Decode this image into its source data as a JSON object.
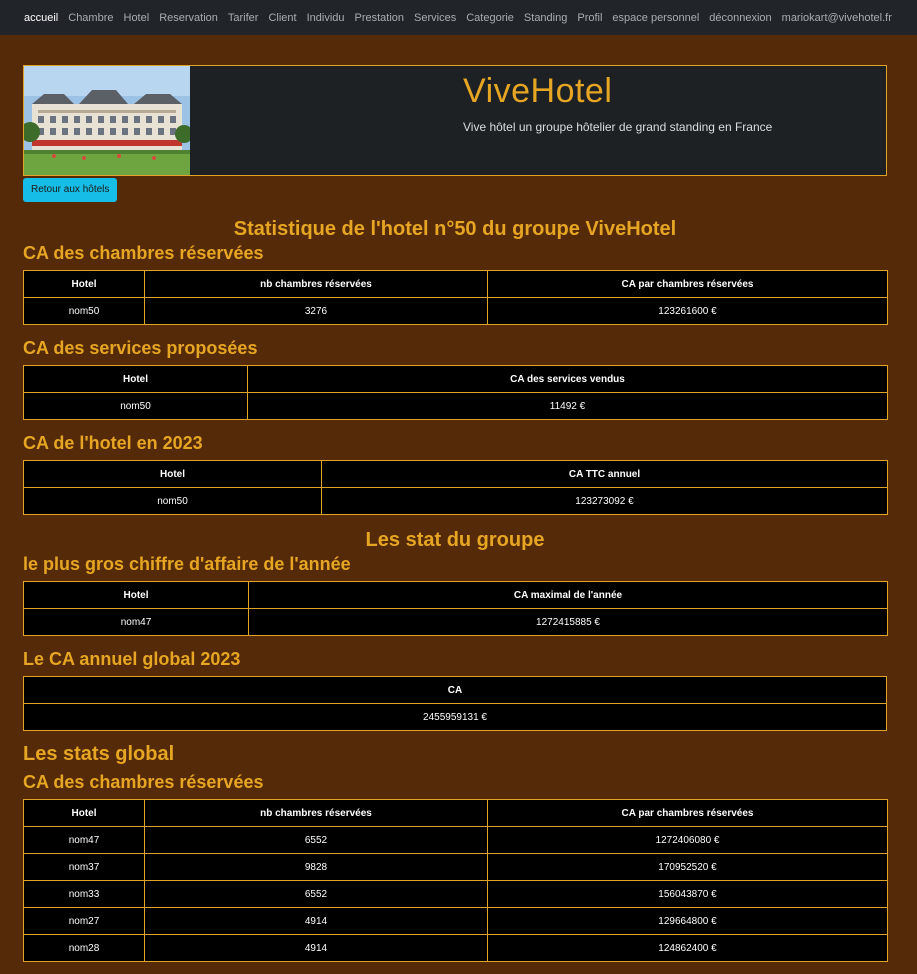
{
  "nav": {
    "items": [
      "accueil",
      "Chambre",
      "Hotel",
      "Reservation",
      "Tarifer",
      "Client",
      "Individu",
      "Prestation",
      "Services",
      "Categorie",
      "Standing",
      "Profil",
      "espace personnel",
      "déconnexion",
      "mariokart@vivehotel.fr"
    ]
  },
  "header": {
    "title": "ViveHotel",
    "subtitle": "Vive hôtel un groupe hôtelier de grand standing en France"
  },
  "back_button": "Retour aux hôtels",
  "page_title": "Statistique de l'hotel n°50 du groupe ViveHotel",
  "hotel_stats": {
    "rooms": {
      "title": "CA des chambres réservées",
      "headers": [
        "Hotel",
        "nb chambres réservées",
        "CA par chambres réservées"
      ],
      "rows": [
        [
          "nom50",
          "3276",
          "123261600 €"
        ]
      ]
    },
    "services": {
      "title": "CA des services proposées",
      "headers": [
        "Hotel",
        "CA des services vendus"
      ],
      "rows": [
        [
          "nom50",
          "11492 €"
        ]
      ]
    },
    "annual": {
      "title": "CA de l'hotel en 2023",
      "headers": [
        "Hotel",
        "CA TTC annuel"
      ],
      "rows": [
        [
          "nom50",
          "123273092 €"
        ]
      ]
    }
  },
  "group_title": "Les stat du groupe",
  "group_stats": {
    "max": {
      "title": "le plus gros chiffre d'affaire de l'année",
      "headers": [
        "Hotel",
        "CA maximal de l'année"
      ],
      "rows": [
        [
          "nom47",
          "1272415885 €"
        ]
      ]
    },
    "global": {
      "title": "Le CA annuel global 2023",
      "headers": [
        "CA"
      ],
      "rows": [
        [
          "2455959131 €"
        ]
      ]
    }
  },
  "global_title": "Les stats global",
  "global_stats": {
    "rooms": {
      "title": "CA des chambres réservées",
      "headers": [
        "Hotel",
        "nb chambres réservées",
        "CA par chambres réservées"
      ],
      "rows": [
        [
          "nom47",
          "6552",
          "1272406080 €"
        ],
        [
          "nom37",
          "9828",
          "170952520 €"
        ],
        [
          "nom33",
          "6552",
          "156043870 €"
        ],
        [
          "nom27",
          "4914",
          "129664800 €"
        ],
        [
          "nom28",
          "4914",
          "124862400 €"
        ]
      ]
    }
  },
  "colors": {
    "accent": "#e6a623",
    "background": "#552a09",
    "button": "#16bde6",
    "navbar": "#212529"
  }
}
